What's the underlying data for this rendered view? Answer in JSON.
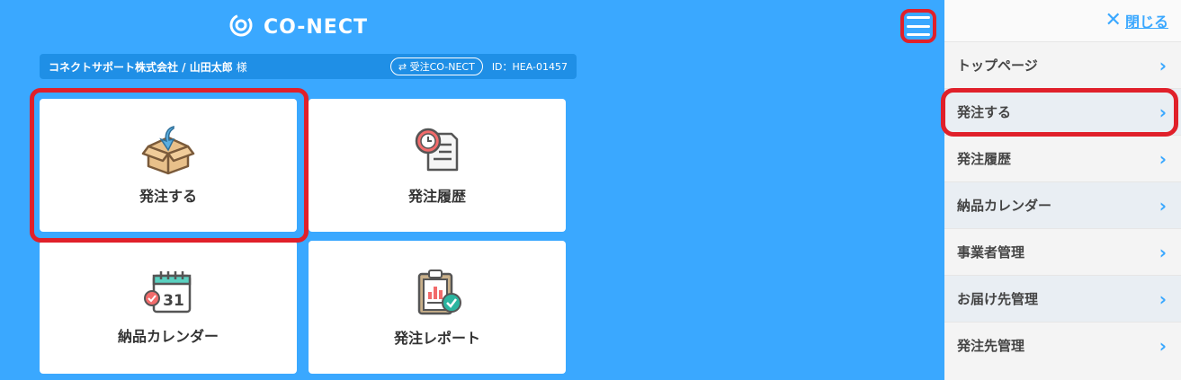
{
  "header": {
    "brand": "CO-NECT"
  },
  "userbar": {
    "company_user": "コネクトサポート株式会社 / 山田太郎",
    "honorific": "様",
    "order_switch": "⇄ 受注CO-NECT",
    "id_text": "ID：HEA-01457"
  },
  "tiles": [
    {
      "label": "発注する",
      "icon": "box-order-icon"
    },
    {
      "label": "発注履歴",
      "icon": "clock-document-icon"
    },
    {
      "label": "納品カレンダー",
      "icon": "calendar-icon"
    },
    {
      "label": "発注レポート",
      "icon": "report-clipboard-icon"
    }
  ],
  "calendar_day": "31",
  "sidemenu": {
    "close_label": "閉じる",
    "items": [
      {
        "label": "トップページ"
      },
      {
        "label": "発注する"
      },
      {
        "label": "発注履歴"
      },
      {
        "label": "納品カレンダー"
      },
      {
        "label": "事業者管理"
      },
      {
        "label": "お届け先管理"
      },
      {
        "label": "発注先管理"
      }
    ]
  },
  "colors": {
    "background": "#3aa8ff",
    "highlight": "#e0202a",
    "accent": "#3aa8ff"
  }
}
